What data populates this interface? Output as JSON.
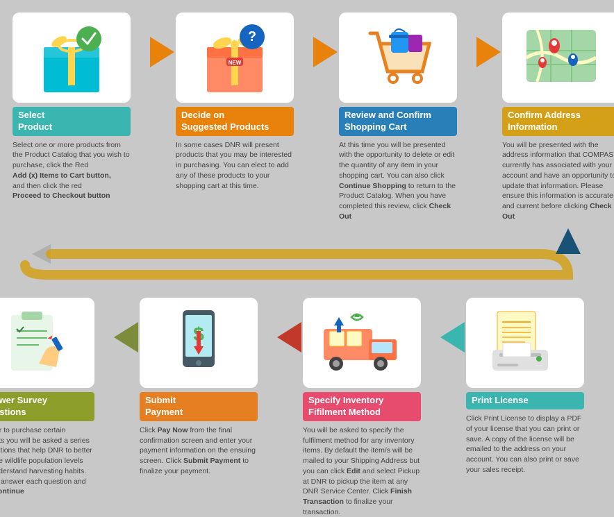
{
  "steps_top": [
    {
      "id": "select-product",
      "title": "Select\nProduct",
      "title_color": "teal",
      "icon": "gift-check",
      "description": "Select one or more products from the Product Catalog that you wish to purchase, click the Red",
      "desc_bold1": "Add (x) Items to Cart button,",
      "desc_mid": "and then click the red",
      "desc_bold2": "Proceed to Checkout button"
    },
    {
      "id": "decide-suggested",
      "title": "Decide on\nSuggested Products",
      "title_color": "orange",
      "icon": "question-gift",
      "description": "In some cases DNR will present products that you may be interested in purchasing. You can elect to add any of these products to your shopping cart at this time."
    },
    {
      "id": "review-cart",
      "title": "Review and Confirm\nShopping Cart",
      "title_color": "blue",
      "icon": "shopping-cart",
      "description": "At this time you will be presented with the opportunity to delete or edit the quantity of any item in your shopping cart. You can also click",
      "desc_bold1": "Continue Shopping",
      "desc_mid": "to return to the Product Catalog. When you have completed this review, click",
      "desc_bold2": "Check Out"
    },
    {
      "id": "confirm-address",
      "title": "Confirm Address\nInformation",
      "title_color": "gold",
      "icon": "map",
      "description": "You will be presented with the address information that COMPASS currently has associated with your account and have an opportunity to update that information. Please ensure this information is accurate and current before clicking",
      "desc_bold1": "Check Out"
    }
  ],
  "steps_bottom": [
    {
      "id": "print-license",
      "title": "Print License",
      "title_color": "teal",
      "icon": "printer",
      "description": "Click Print License to display a PDF of your license that you can print or save. A copy of the license will be emailed to the address on your account. You can also print or save your sales receipt."
    },
    {
      "id": "specify-inventory",
      "title": "Specify Inventory\nFifilment Method",
      "title_color": "pink",
      "icon": "truck-boxes",
      "description": "You will be asked to specify the fulfilment method for any inventory items. By default the item/s will be mailed to your Shipping Address but you can click",
      "desc_bold1": "Edit",
      "desc_mid": "and select Pickup at DNR to pickup the item at any DNR Service Center. Click",
      "desc_bold2": "Finish Transaction",
      "desc_end": "to finalize your transaction."
    },
    {
      "id": "submit-payment",
      "title": "Submit\nPayment",
      "title_color": "amber",
      "icon": "payment",
      "description": "Click",
      "desc_bold1": "Pay Now",
      "desc_mid": "from the final confirmation screen and enter your payment information on the ensuing screen. Click",
      "desc_bold2": "Submit Payment",
      "desc_end": "to finalize your payment."
    },
    {
      "id": "answer-survey",
      "title": "Answer Survey\nQuestions",
      "title_color": "olive",
      "icon": "survey",
      "description": "In order to purchase certain products you will be asked a series of questions that help DNR to better manage wildlife population levels and understand harvesting habits. Please answer each question and click",
      "desc_bold1": "Continue"
    }
  ],
  "arrows": {
    "top_color": "#e8820a",
    "bottom_color": "#c0392b",
    "curve_color": "#d4a017",
    "down_color": "#1a5276"
  }
}
